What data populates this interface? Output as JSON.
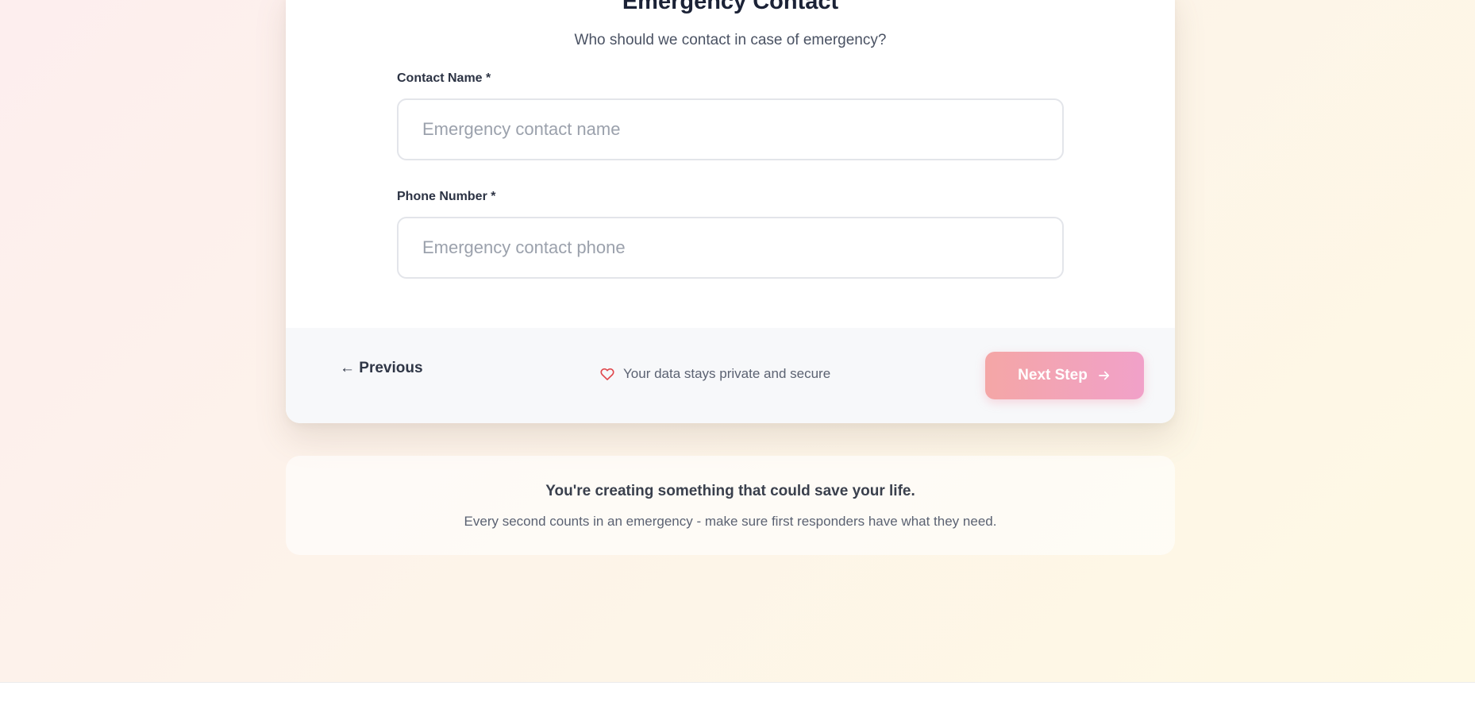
{
  "form": {
    "title": "Emergency Contact",
    "subtitle": "Who should we contact in case of emergency?",
    "fields": [
      {
        "label": "Contact Name *",
        "placeholder": "Emergency contact name",
        "value": ""
      },
      {
        "label": "Phone Number *",
        "placeholder": "Emergency contact phone",
        "value": ""
      }
    ]
  },
  "footer": {
    "previous_label": "← Previous",
    "privacy_text": "Your data stays private and secure",
    "next_label": "Next Step"
  },
  "info": {
    "title": "You're creating something that could save your life.",
    "text": "Every second counts in an emergency - make sure first responders have what they need."
  },
  "colors": {
    "next_gradient_start": "#f4a6a6",
    "next_gradient_end": "#f1a1c9",
    "heart": "#e0474c",
    "title": "#1b2236"
  },
  "icons": {
    "privacy": "heart-icon",
    "next": "arrow-right-icon"
  }
}
